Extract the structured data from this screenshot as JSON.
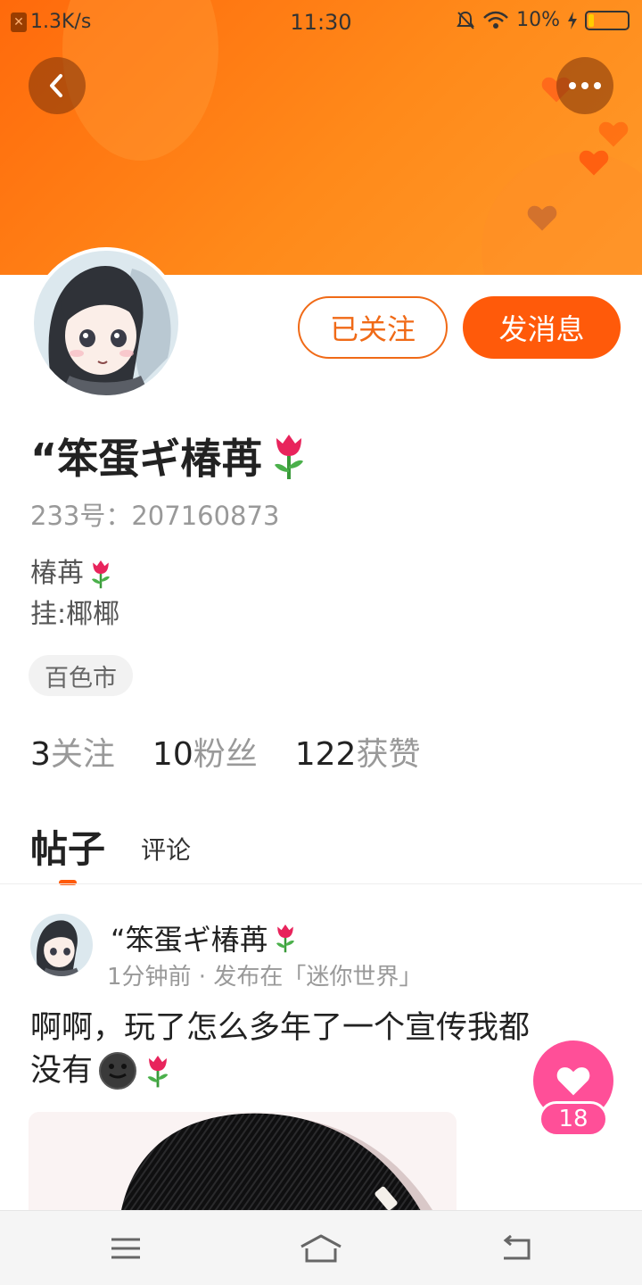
{
  "status_bar": {
    "net_speed": "1.3K/s",
    "time": "11:30",
    "battery": "10%"
  },
  "icons": {
    "back": "chevron-left-icon",
    "more": "more-dots-icon",
    "like": "heart-icon",
    "menu": "menu-icon",
    "home": "home-icon",
    "back_nav": "back-icon"
  },
  "profile": {
    "name": "“笨蛋ギ椿苒",
    "id_text": "233号：207160873",
    "bio_lines": [
      "椿苒",
      "挂:椰椰"
    ],
    "location": "百色市",
    "followed_label": "已关注",
    "message_label": "发消息",
    "stats": {
      "following_num": "3",
      "following_label": "关注",
      "fans_num": "10",
      "fans_label": "粉丝",
      "likes_num": "122",
      "likes_label": "获赞"
    }
  },
  "tabs": [
    {
      "label": "帖子",
      "active": true
    },
    {
      "label": "评论",
      "active": false
    }
  ],
  "post": {
    "author": "“笨蛋ギ椿苒",
    "meta": "1分钟前 · 发布在「迷你世界」",
    "text_line1": "啊啊，玩了怎么多年了一个宣传我都",
    "text_line2": "没有",
    "like_count": "18"
  },
  "colors": {
    "accent": "#ff5a0a",
    "banner": "#ff7a12",
    "like": "#ff4f98"
  }
}
